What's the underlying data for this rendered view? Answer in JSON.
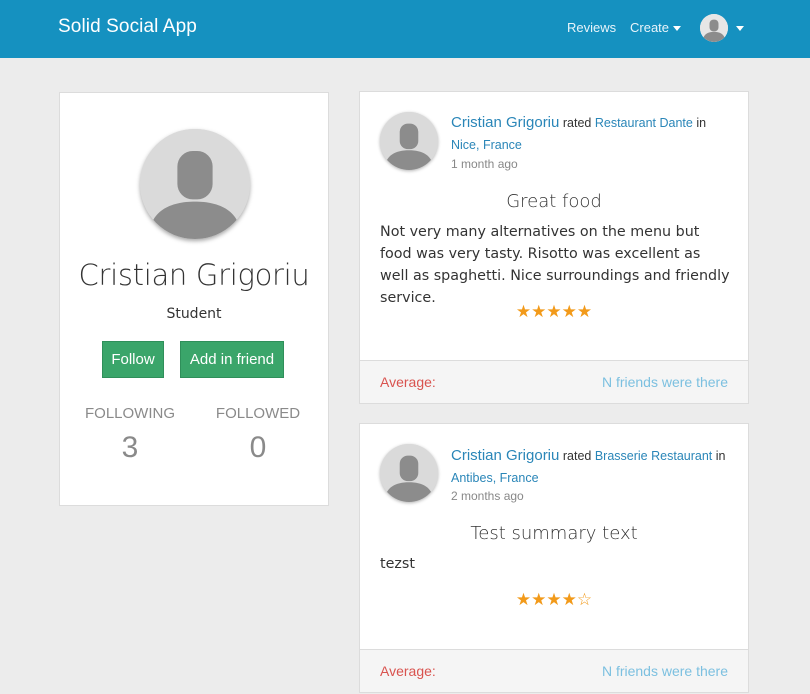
{
  "navbar": {
    "brand": "Solid Social App",
    "reviews_label": "Reviews",
    "create_label": "Create",
    "brand_color": "#1591c0"
  },
  "profile": {
    "name": "Cristian Grigoriu",
    "role": "Student",
    "follow_label": "Follow",
    "add_friend_label": "Add in friend",
    "following_label": "FOLLOWING",
    "following_count": "3",
    "followed_label": "FOLLOWED",
    "followed_count": "0"
  },
  "reviews": [
    {
      "author": "Cristian Grigoriu",
      "rated_word": "rated",
      "place": "Restaurant Dante",
      "in_word": "in",
      "location": "Nice, France",
      "time": "1 month ago",
      "title": "Great food",
      "body": "Not very many alternatives on the menu but food was very tasty. Risotto was excellent as well as spaghetti. Nice surroundings and friendly service.",
      "rating": 5,
      "stars": "★★★★★",
      "average_label": "Average:",
      "friends_label": "N friends were there"
    },
    {
      "author": "Cristian Grigoriu",
      "rated_word": "rated",
      "place": "Brasserie Restaurant",
      "in_word": "in",
      "location": "Antibes, France",
      "time": "2 months ago",
      "title": "Test summary text",
      "body": "tezst",
      "rating": 4,
      "stars": "★★★★☆",
      "average_label": "Average:",
      "friends_label": "N friends were there"
    }
  ],
  "colors": {
    "button_green": "#3aa56a",
    "link_blue": "#2a86b8",
    "star_orange": "#f29a1a",
    "average_red": "#d9534f"
  },
  "icons": {
    "avatar": "user-silhouette-icon",
    "star": "star-icon",
    "caret": "caret-down-icon"
  }
}
